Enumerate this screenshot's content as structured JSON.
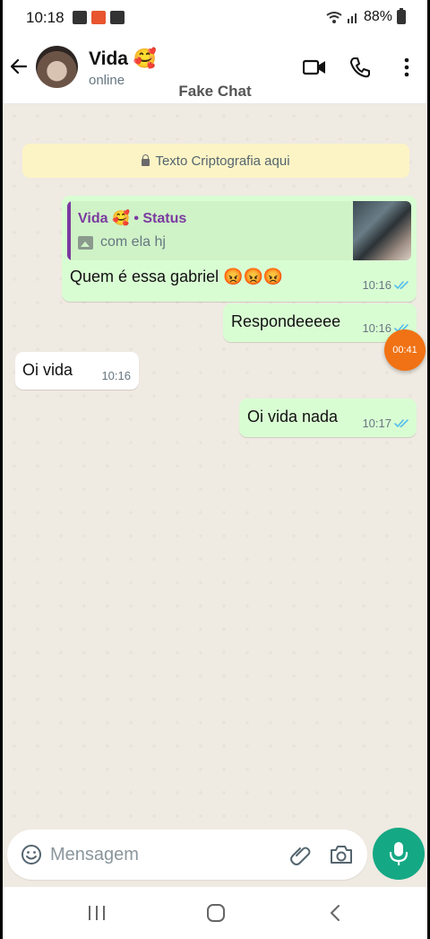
{
  "status_bar": {
    "time": "10:18",
    "battery": "88%",
    "notif_icon_colors": [
      "#333333",
      "#e8552f",
      "#333333"
    ]
  },
  "header": {
    "contact_name": "Vida 🥰",
    "contact_status": "online",
    "watermark": "Fake Chat",
    "icons": [
      "back-arrow-icon",
      "video-call-icon",
      "voice-call-icon",
      "more-options-icon"
    ]
  },
  "chat": {
    "encryption_notice": "Texto Criptografia aqui",
    "messages": [
      {
        "direction": "outgoing",
        "reply_to": {
          "title": "Vida 🥰 • Status",
          "body": "com ela hj",
          "thumbnail": "status-image"
        },
        "text": "Quem é essa gabriel 😡😡😡",
        "time": "10:16",
        "status": "read"
      },
      {
        "direction": "outgoing",
        "text": "Respondeeeee",
        "time": "10:16",
        "status": "read"
      },
      {
        "direction": "incoming",
        "text": "Oi vida",
        "time": "10:16"
      },
      {
        "direction": "outgoing",
        "text": "Oi vida nada",
        "time": "10:17",
        "status": "read"
      }
    ],
    "recording_timer": "00:41"
  },
  "composer": {
    "placeholder": "Mensagem",
    "value": "",
    "icons": [
      "emoji-icon",
      "attach-icon",
      "camera-icon",
      "mic-icon"
    ]
  },
  "colors": {
    "outgoing_bubble": "#d9fdd3",
    "incoming_bubble": "#ffffff",
    "accent": "#15a884",
    "read_ticks": "#53bdeb",
    "status_title": "#7b3aa0",
    "timer": "#f07214",
    "encryption_bg": "#fdf4c5"
  }
}
